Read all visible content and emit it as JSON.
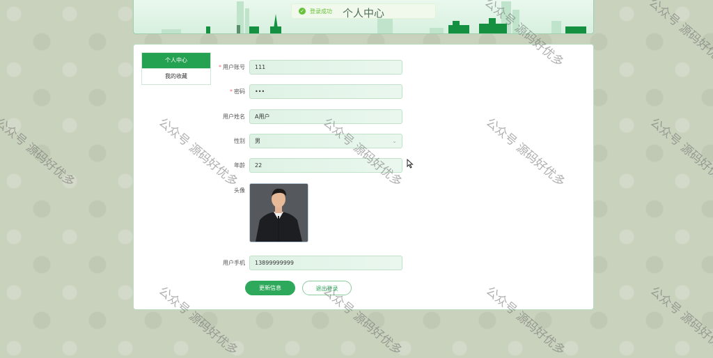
{
  "header": {
    "title": "个人中心",
    "toast": "登录成功"
  },
  "sidebar": {
    "items": [
      {
        "label": "个人中心",
        "active": true
      },
      {
        "label": "我的收藏",
        "active": false
      }
    ]
  },
  "form": {
    "account": {
      "label": "用户账号",
      "value": "111",
      "required": true
    },
    "password": {
      "label": "密码",
      "value": "•••",
      "required": true
    },
    "name": {
      "label": "用户姓名",
      "value": "A用户"
    },
    "gender": {
      "label": "性别",
      "value": "男"
    },
    "age": {
      "label": "年龄",
      "value": "22"
    },
    "avatar": {
      "label": "头像"
    },
    "phone": {
      "label": "用户手机",
      "value": "13899999999"
    }
  },
  "buttons": {
    "update": "更新信息",
    "logout": "退出登录"
  },
  "watermark": "公众号 源码好优多",
  "colors": {
    "primary": "#25a152",
    "banner_bg": "#d7f0df",
    "toast_green": "#67c23a",
    "required": "#f56c6c"
  }
}
